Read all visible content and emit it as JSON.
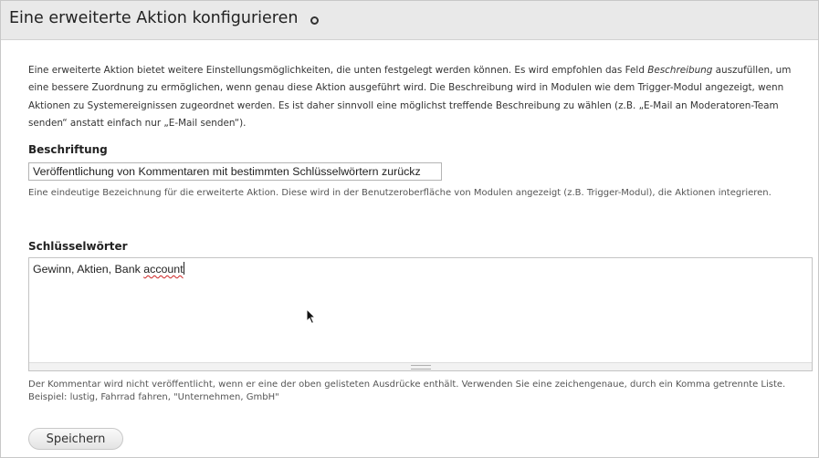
{
  "header": {
    "title": "Eine erweiterte Aktion konfigurieren",
    "icon": "circle-icon"
  },
  "intro": {
    "text_before": "Eine erweiterte Aktion bietet weitere Einstellungsmöglichkeiten, die unten festgelegt werden können. Es wird empfohlen das Feld ",
    "emphasis": "Beschreibung",
    "text_after": " auszufüllen, um eine bessere Zuordnung zu ermöglichen, wenn genau diese Aktion ausgeführt wird. Die Beschreibung wird in Modulen wie dem Trigger-Modul angezeigt, wenn Aktionen zu Systemereignissen zugeordnet werden. Es ist daher sinnvoll eine möglichst treffende Beschreibung zu wählen (z.B. „E-Mail an Moderatoren-Team senden“ anstatt einfach nur „E-Mail senden“)."
  },
  "label_field": {
    "label": "Beschriftung",
    "value": "Veröffentlichung von Kommentaren mit bestimmten Schlüsselwörtern zurückz",
    "description": "Eine eindeutige Bezeichnung für die erweiterte Aktion. Diese wird in der Benutzeroberfläche von Modulen angezeigt (z.B. Trigger-Modul), die Aktionen integrieren."
  },
  "keywords_field": {
    "label": "Schlüsselwörter",
    "value_plain": "Gewinn, Aktien, Bank ",
    "value_misspelled": "account",
    "description": "Der Kommentar wird nicht veröffentlicht, wenn er eine der oben gelisteten Ausdrücke enthält. Verwenden Sie eine zeichengenaue, durch ein Komma getrennte Liste. Beispiel: lustig, Fahrrad fahren, \"Unternehmen, GmbH\""
  },
  "actions": {
    "save_label": "Speichern"
  },
  "colors": {
    "header_bg": "#e9e9e9",
    "spellcheck": "#cc2222"
  }
}
